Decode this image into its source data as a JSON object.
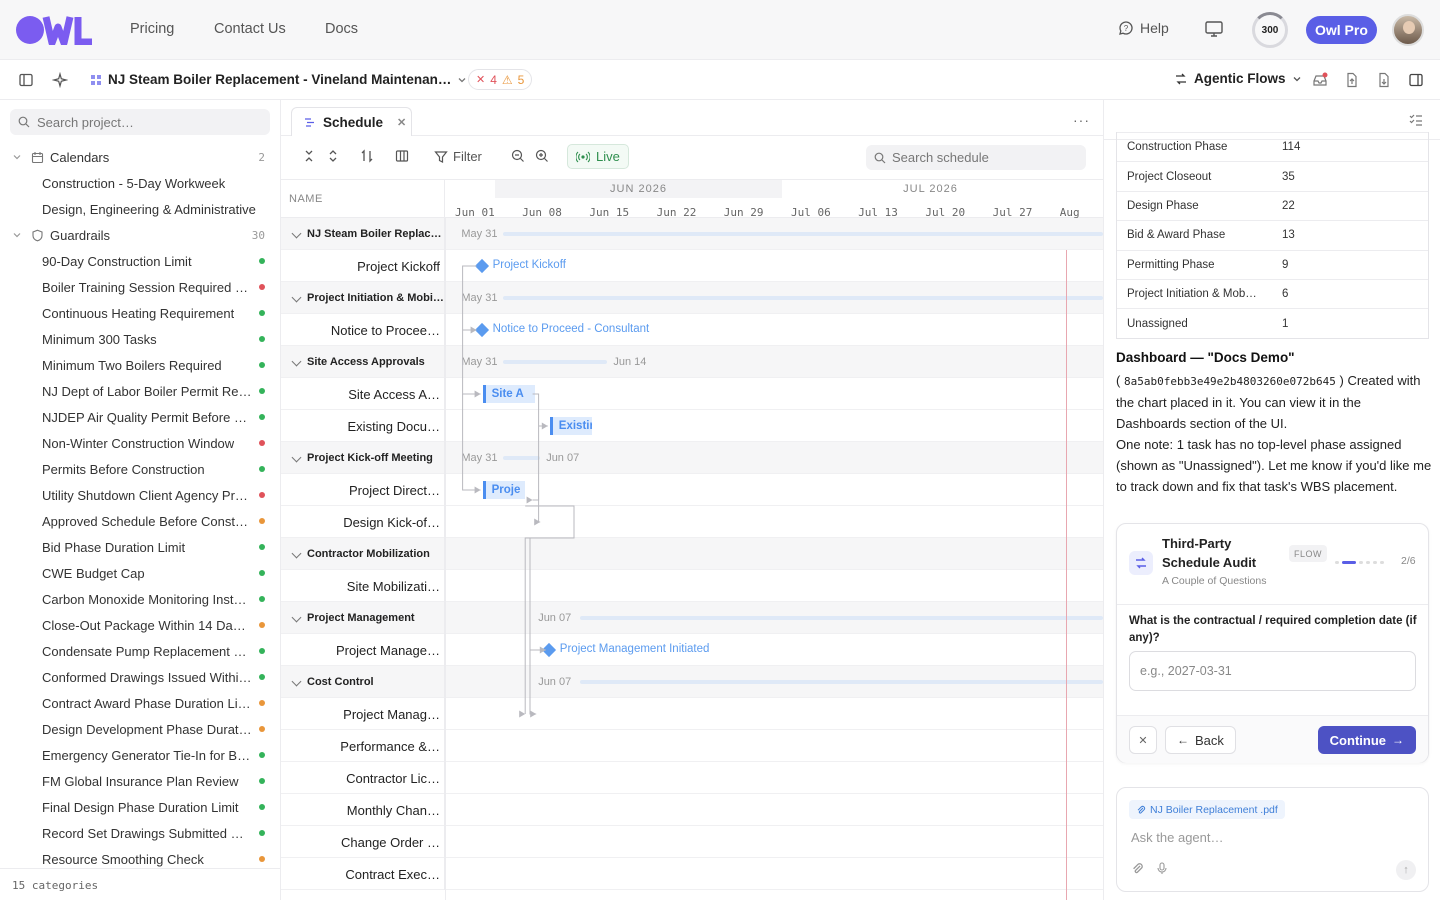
{
  "nav": {
    "links": [
      "Pricing",
      "Contact Us",
      "Docs"
    ],
    "help": "Help",
    "credits": "300",
    "credits_fraction": 0.15,
    "pro_label": "Owl Pro"
  },
  "toolbar": {
    "project_title": "NJ Steam Boiler Replacement - Vineland Maintenan…",
    "errors": "4",
    "warnings": "5",
    "agentic_label": "Agentic Flows"
  },
  "sidebar": {
    "search_placeholder": "Search project…",
    "groups": [
      {
        "label": "Calendars",
        "count": "2"
      },
      {
        "label": "Guardrails",
        "count": "30"
      }
    ],
    "calendars": [
      "Construction - 5-Day Workweek",
      "Design, Engineering & Administrative"
    ],
    "guardrails": [
      {
        "label": "90-Day Construction Limit",
        "status": "green"
      },
      {
        "label": "Boiler Training Session Required B…",
        "status": "red"
      },
      {
        "label": "Continuous Heating Requirement",
        "status": "green"
      },
      {
        "label": "Minimum 300 Tasks",
        "status": "green"
      },
      {
        "label": "Minimum Two Boilers Required",
        "status": "green"
      },
      {
        "label": "NJ Dept of Labor Boiler Permit Re…",
        "status": "green"
      },
      {
        "label": "NJDEP Air Quality Permit Before C…",
        "status": "green"
      },
      {
        "label": "Non-Winter Construction Window",
        "status": "red"
      },
      {
        "label": "Permits Before Construction",
        "status": "green"
      },
      {
        "label": "Utility Shutdown Client Agency Pr…",
        "status": "red"
      },
      {
        "label": "Approved Schedule Before Constr…",
        "status": "orange"
      },
      {
        "label": "Bid Phase Duration Limit",
        "status": "green"
      },
      {
        "label": "CWE Budget Cap",
        "status": "green"
      },
      {
        "label": "Carbon Monoxide Monitoring Insta…",
        "status": "green"
      },
      {
        "label": "Close-Out Package Within 14 Days…",
        "status": "orange"
      },
      {
        "label": "Condensate Pump Replacement R…",
        "status": "green"
      },
      {
        "label": "Conformed Drawings Issued Withi…",
        "status": "green"
      },
      {
        "label": "Contract Award Phase Duration Li…",
        "status": "orange"
      },
      {
        "label": "Design Development Phase Durati…",
        "status": "orange"
      },
      {
        "label": "Emergency Generator Tie-In for Bo…",
        "status": "green"
      },
      {
        "label": "FM Global Insurance Plan Review",
        "status": "green"
      },
      {
        "label": "Final Design Phase Duration Limit",
        "status": "green"
      },
      {
        "label": "Record Set Drawings Submitted W…",
        "status": "green"
      },
      {
        "label": "Resource Smoothing Check",
        "status": "orange"
      }
    ],
    "footer": "15 categories"
  },
  "colors": {
    "green": "#34b35a",
    "red": "#e0525a",
    "orange": "#e9963a",
    "accent": "#5a5ee6"
  },
  "schedule": {
    "tab_label": "Schedule",
    "filter_label": "Filter",
    "live_label": "Live",
    "search_placeholder": "Search schedule",
    "name_header": "NAME",
    "months": [
      "JUN 2026",
      "JUL 2026"
    ],
    "weeks": [
      "Jun 01",
      "Jun 08",
      "Jun 15",
      "Jun 22",
      "Jun 29",
      "Jul 06",
      "Jul 13",
      "Jul 20",
      "Jul 27",
      "Aug"
    ],
    "rows": [
      {
        "type": "group",
        "name": "NJ Steam Boiler Replace…",
        "start_label": "May 31"
      },
      {
        "type": "task",
        "name": "Project Kickoff",
        "milestone": "Project Kickoff"
      },
      {
        "type": "group",
        "name": "Project Initiation & Mobili…",
        "start_label": "May 31"
      },
      {
        "type": "task",
        "name": "Notice to Procee…",
        "milestone": "Notice to Proceed - Consultant"
      },
      {
        "type": "group",
        "name": "Site Access Approvals",
        "start_label": "May 31",
        "end_label": "Jun 14"
      },
      {
        "type": "task",
        "name": "Site Access A…",
        "bar": "Site A"
      },
      {
        "type": "task",
        "name": "Existing Docu…",
        "bar": "Existing D"
      },
      {
        "type": "group",
        "name": "Project Kick-off Meeting",
        "start_label": "May 31",
        "end_label": "Jun 07"
      },
      {
        "type": "task",
        "name": "Project Direct…",
        "bar": "Proje"
      },
      {
        "type": "task",
        "name": "Design Kick-of…"
      },
      {
        "type": "group",
        "name": "Contractor Mobilization"
      },
      {
        "type": "task",
        "name": "Site Mobilizati…"
      },
      {
        "type": "group",
        "name": "Project Management",
        "start_label": "Jun 07"
      },
      {
        "type": "task",
        "name": "Project Manage…",
        "milestone": "Project Management Initiated"
      },
      {
        "type": "group",
        "name": "Cost Control",
        "start_label": "Jun 07"
      },
      {
        "type": "task",
        "name": "Project Manag…"
      },
      {
        "type": "task",
        "name": "Performance &…"
      },
      {
        "type": "task",
        "name": "Contractor Lic…"
      },
      {
        "type": "task",
        "name": "Monthly Chan…"
      },
      {
        "type": "task",
        "name": "Change Order …"
      },
      {
        "type": "task",
        "name": "Contract Exec…"
      }
    ]
  },
  "right_panel": {
    "phases": [
      {
        "name": "Construction Phase",
        "count": "114"
      },
      {
        "name": "Project Closeout",
        "count": "35"
      },
      {
        "name": "Design Phase",
        "count": "22"
      },
      {
        "name": "Bid & Award Phase",
        "count": "13"
      },
      {
        "name": "Permitting Phase",
        "count": "9"
      },
      {
        "name": "Project Initiation & Mob…",
        "count": "6"
      },
      {
        "name": "Unassigned",
        "count": "1"
      }
    ],
    "dashboard_title": "Dashboard — \"Docs Demo\"",
    "dashboard_open_paren": "(",
    "dashboard_id": "8a5ab0febb3e49e2b4803260e072b645",
    "dashboard_text_1": ") Created with the chart placed in it. You can view it in the Dashboards section of the UI.",
    "dashboard_text_2": "One note: 1 task has no top-level phase assigned (shown as \"Unassigned\"). Let me know if you'd like me to track down and fix that task's WBS placement.",
    "flow": {
      "title": "Third-Party Schedule Audit",
      "subtitle": "A Couple of Questions",
      "badge": "FLOW",
      "step": "2/6",
      "question": "What is the contractual / required completion date (if any)?",
      "input_placeholder": "e.g., 2027-03-31",
      "back_label": "Back",
      "continue_label": "Continue"
    },
    "chat": {
      "attachment": "NJ Boiler Replacement .pdf",
      "placeholder": "Ask the agent…"
    }
  }
}
